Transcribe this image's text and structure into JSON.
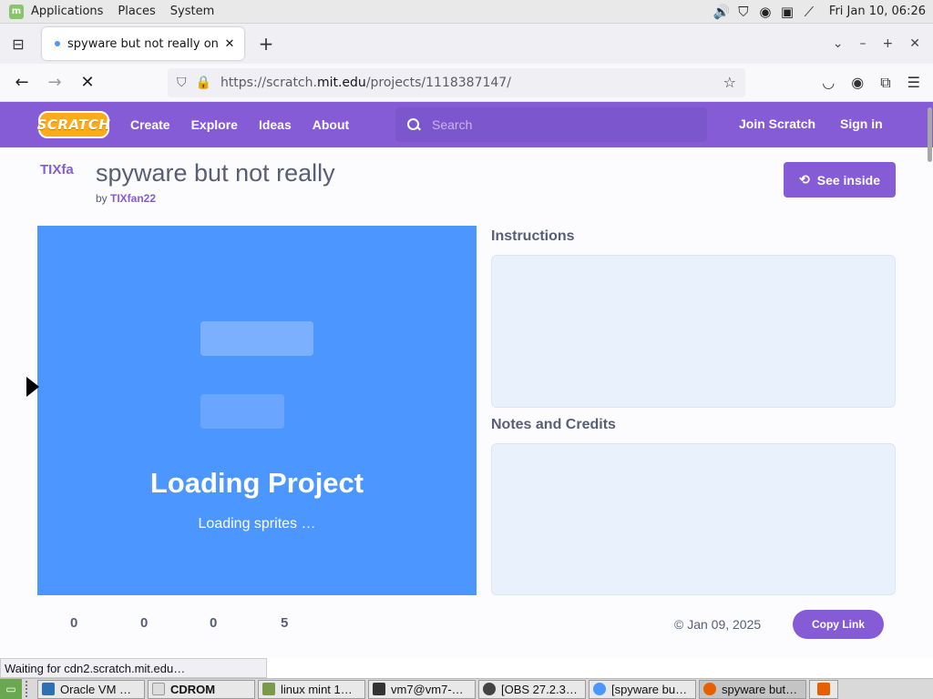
{
  "system_panel": {
    "menus": [
      "Applications",
      "Places",
      "System"
    ],
    "clock": "Fri Jan 10, 06:26"
  },
  "browser": {
    "tab_title": "spyware but not really on Sc",
    "url_prefix": "https://scratch.",
    "url_domain": "mit.edu",
    "url_suffix": "/projects/1118387147/",
    "status_text": "Waiting for cdn2.scratch.mit.edu…"
  },
  "scratch_nav": {
    "logo": "SCRATCH",
    "links": [
      "Create",
      "Explore",
      "Ideas",
      "About"
    ],
    "search_placeholder": "Search",
    "join": "Join Scratch",
    "signin": "Sign in"
  },
  "project": {
    "avatar_text": "TIXfa",
    "title": "spyware but not really",
    "by": "by ",
    "author": "TIXfan22",
    "see_inside": "See inside",
    "loading_title": "Loading Project",
    "loading_sub": "Loading sprites …",
    "instructions_label": "Instructions",
    "notes_label": "Notes and Credits",
    "stats": [
      "0",
      "0",
      "0",
      "5"
    ],
    "date": "© Jan 09, 2025",
    "copy_link": "Copy Link"
  },
  "taskbar": {
    "items": [
      {
        "label": "Oracle VM …",
        "color": "#2f6fb3"
      },
      {
        "label": "CDROM",
        "color": "#dddddd"
      },
      {
        "label": "linux mint 1…",
        "color": "#7a9a4a"
      },
      {
        "label": "vm7@vm7-…",
        "color": "#333333"
      },
      {
        "label": "[OBS 27.2.3…",
        "color": "#444444"
      },
      {
        "label": "[spyware bu…",
        "color": "#4c97ff"
      },
      {
        "label": "spyware but…",
        "color": "#e66000"
      }
    ]
  }
}
